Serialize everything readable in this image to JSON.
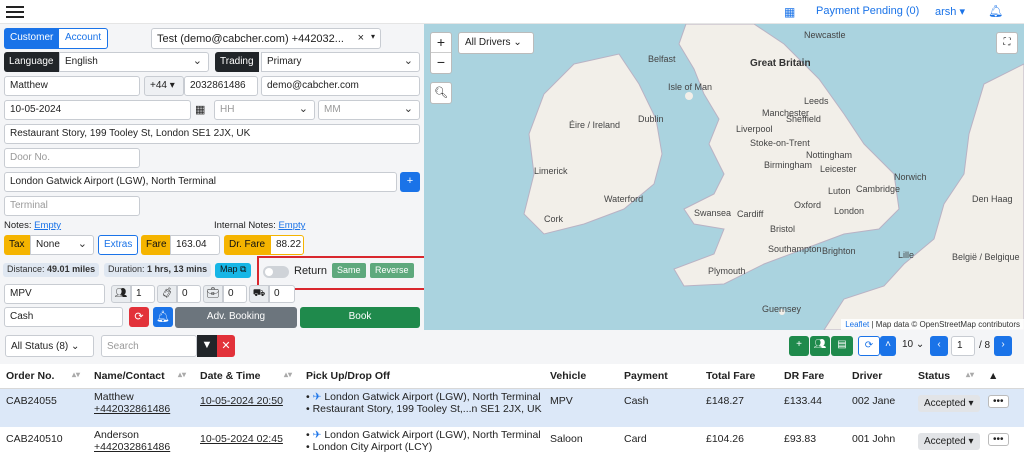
{
  "topbar": {
    "menu_icon": "hamburger-icon",
    "calendar_icon": "calendar-icon",
    "payment_pending": "Payment Pending (0)",
    "user": "arsh",
    "bell_icon": "bell-icon"
  },
  "form": {
    "tab_customer": "Customer",
    "tab_account": "Account",
    "account_select": "Test (demo@cabcher.com) +442032...",
    "language_label": "Language",
    "language_value": "English",
    "trading_label": "Trading",
    "trading_value": "Primary",
    "name": "Matthew",
    "phone_code": "+44",
    "phone": "2032861486",
    "email": "demo@cabcher.com",
    "date": "10-05-2024",
    "hour_placeholder": "HH",
    "minute_placeholder": "MM",
    "pickup": "Restaurant Story, 199 Tooley St, London SE1 2JX, UK",
    "door_placeholder": "Door No.",
    "dropoff": "London Gatwick Airport (LGW), North Terminal",
    "terminal_placeholder": "Terminal",
    "notes_label": "Notes:",
    "notes_link": "Empty",
    "internal_notes_label": "Internal Notes:",
    "internal_notes_link": "Empty",
    "tax_label": "Tax",
    "tax_value": "None",
    "extras_label": "Extras",
    "fare_label": "Fare",
    "fare_value": "163.04",
    "dr_fare_label": "Dr. Fare",
    "dr_fare_value": "88.22",
    "distance_label": "Distance:",
    "distance_value": "49.01 miles",
    "duration_label": "Duration:",
    "duration_value": "1 hrs, 13 mins",
    "map_label": "Map",
    "return_label": "Return",
    "same_label": "Same",
    "reverse_label": "Reverse",
    "vehicle": "MPV",
    "passengers": "1",
    "luggage": "0",
    "hand_luggage": "0",
    "child_seats": "0",
    "payment": "Cash",
    "adv_booking_label": "Adv. Booking",
    "book_label": "Book"
  },
  "map": {
    "drivers_filter": "All Drivers",
    "zoom_in": "+",
    "zoom_out": "−",
    "attribution_leaflet": "Leaflet",
    "attribution_text": "| Map data © OpenStreetMap contributors",
    "labels": [
      {
        "t": "Great Britain",
        "big": true
      },
      {
        "t": "Éire / Ireland"
      },
      {
        "t": "Dublin"
      },
      {
        "t": "Liverpool"
      },
      {
        "t": "Sheffield"
      },
      {
        "t": "Leeds"
      },
      {
        "t": "Manchester"
      },
      {
        "t": "Nottingham"
      },
      {
        "t": "Birmingham"
      },
      {
        "t": "Norwich"
      },
      {
        "t": "Cambridge"
      },
      {
        "t": "Oxford"
      },
      {
        "t": "Cardiff"
      },
      {
        "t": "Bristol"
      },
      {
        "t": "London"
      },
      {
        "t": "Swansea"
      },
      {
        "t": "Southampton"
      },
      {
        "t": "Brighton"
      },
      {
        "t": "Plymouth"
      },
      {
        "t": "Cork"
      },
      {
        "t": "Limerick"
      },
      {
        "t": "Waterford"
      },
      {
        "t": "Den Haag"
      },
      {
        "t": "België / Belgique"
      },
      {
        "t": "Lille"
      },
      {
        "t": "Guernsey"
      },
      {
        "t": "Isle of Man"
      },
      {
        "t": "Newcastle"
      },
      {
        "t": "Belfast"
      },
      {
        "t": "Stoke-on-Trent"
      },
      {
        "t": "Leicester"
      },
      {
        "t": "Luton"
      }
    ]
  },
  "list": {
    "status_filter": "All Status (8)",
    "search_placeholder": "Search",
    "page_size": "10",
    "page_current": "1",
    "page_total": "/ 8"
  },
  "table": {
    "headers": [
      "Order No.",
      "Name/Contact",
      "Date & Time",
      "Pick Up/Drop Off",
      "Vehicle",
      "Payment",
      "Total Fare",
      "DR Fare",
      "Driver",
      "Status"
    ],
    "rows": [
      {
        "order": "CAB24055",
        "name": "Matthew",
        "contact": "+442032861486",
        "datetime": "10-05-2024 20:50",
        "pickup": "London Gatwick Airport (LGW), North Terminal",
        "dropoff": "Restaurant Story, 199 Tooley St,...n SE1 2JX, UK",
        "vehicle": "MPV",
        "payment": "Cash",
        "total": "£148.27",
        "dr": "£133.44",
        "driver": "002 Jane",
        "status": "Accepted"
      },
      {
        "order": "CAB240510",
        "name": "Anderson",
        "contact": "+442032861486",
        "datetime": "10-05-2024 02:45",
        "pickup": "London Gatwick Airport (LGW), North Terminal",
        "dropoff": "London City Airport (LCY)",
        "vehicle": "Saloon",
        "payment": "Card",
        "total": "£104.26",
        "dr": "£93.83",
        "driver": "001 John",
        "status": "Accepted"
      }
    ]
  }
}
